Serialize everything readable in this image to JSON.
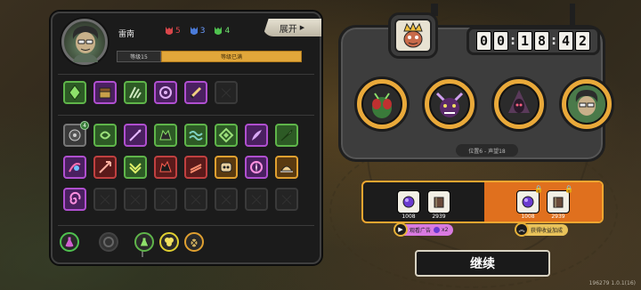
{
  "player": {
    "name": "雷南",
    "level_label": "等级15",
    "level_status": "等级已满"
  },
  "stats": [
    {
      "icon": "red-mask-icon",
      "value": "5",
      "color": "#d9464a"
    },
    {
      "icon": "blue-mask-icon",
      "value": "3",
      "color": "#4a7bd9"
    },
    {
      "icon": "green-mask-icon",
      "value": "4",
      "color": "#4fc24f"
    }
  ],
  "expand_label": "展开",
  "equipped_badge": "4",
  "timer": {
    "d1": "0",
    "d2": "0",
    "d3": "1",
    "d4": "8",
    "d5": "4",
    "d6": "2"
  },
  "position_label": "位置6 - 声望18",
  "rewards": {
    "free": [
      {
        "icon": "purple-orb-icon",
        "value": "1008"
      },
      {
        "icon": "brown-book-icon",
        "value": "2939"
      }
    ],
    "bonus": [
      {
        "icon": "purple-orb-icon",
        "value": "1008"
      },
      {
        "icon": "brown-book-icon",
        "value": "2939"
      }
    ],
    "watch_ad_label": "观看广告",
    "watch_ad_multiplier": "x2",
    "bonus_label": "获得收益加成"
  },
  "continue_label": "继续",
  "version": "196279 1.0.1(16)",
  "colors": {
    "accent": "#e9a93a",
    "orange": "#e0701e"
  }
}
